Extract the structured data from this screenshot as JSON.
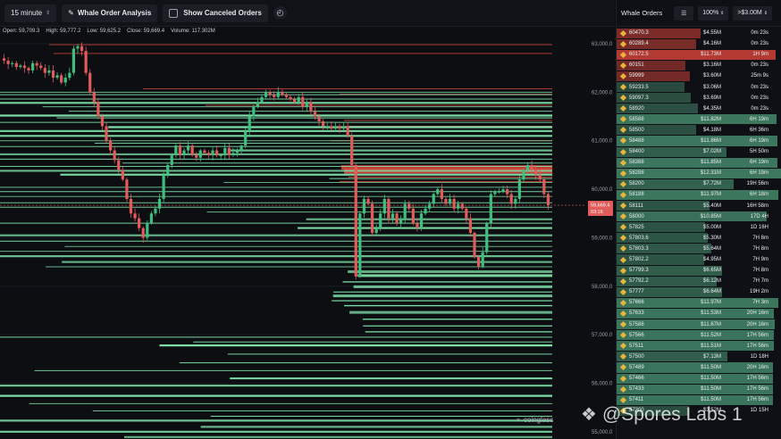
{
  "toolbar": {
    "interval": "15 minute",
    "whale_analysis": "Whale Order Analysis",
    "show_canceled": "Show Canceled Orders"
  },
  "ohlc": {
    "open": "Open: 59,709.3",
    "high": "High: 59,777.2",
    "low": "Low: 59,625.2",
    "close": "Close: 59,669.4",
    "volume": "Volume: 117.302M"
  },
  "price_tag": {
    "price": "59,669.4",
    "countdown": "03:16"
  },
  "colors": {
    "bid": "#7fe0a8",
    "ask": "#e2473b",
    "up": "#3fbf7f",
    "down": "#e25b5b"
  },
  "chart_data": {
    "type": "candlestick",
    "y_axis_ticks": [
      "63,000.0",
      "62,000.0",
      "61,000.0",
      "60,000.0",
      "59,000.0",
      "58,000.0",
      "57,000.0",
      "56,000.0",
      "55,000.0"
    ],
    "ylim": [
      54850,
      63350
    ],
    "current_price": 59669.4,
    "price_path": [
      62700,
      62650,
      62580,
      62600,
      62520,
      62550,
      62500,
      62450,
      62600,
      62550,
      62500,
      62400,
      62450,
      62300,
      62350,
      62200,
      62300,
      62400,
      62900,
      62950,
      62850,
      62400,
      62000,
      61800,
      61500,
      61300,
      61000,
      60800,
      60600,
      60400,
      60200,
      59800,
      59500,
      59400,
      59200,
      59000,
      59300,
      59500,
      59600,
      59800,
      60300,
      60500,
      60700,
      60900,
      60700,
      60800,
      60900,
      60700,
      60650,
      60800,
      60750,
      60700,
      60800,
      60700,
      60700,
      60850,
      60700,
      60750,
      60800,
      60900,
      61200,
      61500,
      61700,
      61800,
      61900,
      62000,
      61950,
      61900,
      62000,
      61950,
      61900,
      61850,
      61800,
      61900,
      61700,
      61800,
      61600,
      61500,
      61400,
      61300,
      61300,
      61250,
      61300,
      61250,
      61300,
      61100,
      60500,
      58200,
      59500,
      59800,
      59700,
      59100,
      59200,
      59500,
      59800,
      59400,
      59500,
      59300,
      59400,
      59700,
      59600,
      59300,
      59200,
      59500,
      59600,
      59700,
      59900,
      60000,
      59800,
      59700,
      59800,
      59600,
      59700,
      59600,
      59400,
      59100,
      58600,
      58400,
      58700,
      59300,
      59900,
      59950,
      59950,
      60000,
      59900,
      59700,
      59800,
      60200,
      60400,
      60500,
      60400,
      60300,
      60200,
      59900,
      59669
    ],
    "whale_bid_levels": [
      62000,
      61950,
      61860,
      61780,
      61700,
      61610,
      61520,
      61470,
      61380,
      61280,
      61200,
      61100,
      61000,
      60950,
      60880,
      60800,
      60720,
      60620,
      60540,
      60470,
      60380,
      60300,
      60220,
      60140,
      60040,
      59950,
      59850,
      59720,
      59630,
      59530,
      59380,
      59300,
      59200,
      59050,
      58930,
      58820,
      58720,
      58620,
      58500,
      58400,
      58300,
      58220,
      58090,
      57990,
      57880,
      57800,
      57700,
      57600,
      57460,
      57320,
      57180,
      57060,
      56950,
      56850,
      56780,
      56600,
      56420,
      56260,
      56100,
      55950,
      55740,
      55580,
      55430,
      55320,
      55230,
      55100,
      55000,
      54890
    ],
    "whale_ask_levels": [
      62980,
      62800,
      62070,
      61960,
      61730,
      61420,
      61300,
      61000,
      60450,
      60370,
      60250,
      60160
    ]
  },
  "panel": {
    "title": "Whale Orders",
    "zoom": "100%",
    "filter": ">$3.00M",
    "orders": [
      {
        "side": "ask",
        "price": "60470.3",
        "amount": "$4.55M",
        "time": "0m 23s"
      },
      {
        "side": "ask",
        "price": "60289.4",
        "amount": "$4.16M",
        "time": "0m 23s"
      },
      {
        "side": "ask",
        "price": "60172.5",
        "amount": "$11.73M",
        "time": "1H 9m"
      },
      {
        "side": "ask",
        "price": "60151",
        "amount": "$3.16M",
        "time": "0m 23s"
      },
      {
        "side": "ask",
        "price": "59999",
        "amount": "$3.60M",
        "time": "25m 9s"
      },
      {
        "side": "bid",
        "price": "59233.5",
        "amount": "$3.06M",
        "time": "0m 23s"
      },
      {
        "side": "bid",
        "price": "59097.3",
        "amount": "$3.69M",
        "time": "0m 23s"
      },
      {
        "side": "bid",
        "price": "58920",
        "amount": "$4.35M",
        "time": "0m 23s"
      },
      {
        "side": "bid",
        "price": "58588",
        "amount": "$11.82M",
        "time": "6H 19m"
      },
      {
        "side": "bid",
        "price": "58500",
        "amount": "$4.18M",
        "time": "6H 36m"
      },
      {
        "side": "bid",
        "price": "58488",
        "amount": "$11.86M",
        "time": "6H 19m"
      },
      {
        "side": "bid",
        "price": "58400",
        "amount": "$7.02M",
        "time": "5H 50m"
      },
      {
        "side": "bid",
        "price": "58388",
        "amount": "$11.85M",
        "time": "6H 19m"
      },
      {
        "side": "bid",
        "price": "58288",
        "amount": "$12.31M",
        "time": "6H 19m"
      },
      {
        "side": "bid",
        "price": "58200",
        "amount": "$7.72M",
        "time": "19H 56m"
      },
      {
        "side": "bid",
        "price": "58188",
        "amount": "$11.97M",
        "time": "6H 18m"
      },
      {
        "side": "bid",
        "price": "58111",
        "amount": "$5.40M",
        "time": "16H 58m"
      },
      {
        "side": "bid",
        "price": "58000",
        "amount": "$10.85M",
        "time": "17D 4H"
      },
      {
        "side": "bid",
        "price": "57825",
        "amount": "$5.00M",
        "time": "1D 16H"
      },
      {
        "side": "bid",
        "price": "57803.6",
        "amount": "$5.30M",
        "time": "7H 8m"
      },
      {
        "side": "bid",
        "price": "57803.3",
        "amount": "$5.64M",
        "time": "7H 8m"
      },
      {
        "side": "bid",
        "price": "57802.2",
        "amount": "$4.95M",
        "time": "7H 9m"
      },
      {
        "side": "bid",
        "price": "57799.3",
        "amount": "$6.65M",
        "time": "7H 8m"
      },
      {
        "side": "bid",
        "price": "57792.2",
        "amount": "$6.12M",
        "time": "7H 7m"
      },
      {
        "side": "bid",
        "price": "57777",
        "amount": "$6.64M",
        "time": "19H 2m"
      },
      {
        "side": "bid",
        "price": "57666",
        "amount": "$11.97M",
        "time": "7H 3m"
      },
      {
        "side": "bid",
        "price": "57633",
        "amount": "$11.53M",
        "time": "20H 16m"
      },
      {
        "side": "bid",
        "price": "57588",
        "amount": "$11.67M",
        "time": "20H 16m"
      },
      {
        "side": "bid",
        "price": "57566",
        "amount": "$11.52M",
        "time": "17H 56m"
      },
      {
        "side": "bid",
        "price": "57511",
        "amount": "$11.51M",
        "time": "17H 56m"
      },
      {
        "side": "bid",
        "price": "57500",
        "amount": "$7.13M",
        "time": "1D 18H"
      },
      {
        "side": "bid",
        "price": "57489",
        "amount": "$11.50M",
        "time": "20H 16m"
      },
      {
        "side": "bid",
        "price": "57466",
        "amount": "$11.50M",
        "time": "17H 56m"
      },
      {
        "side": "bid",
        "price": "57433",
        "amount": "$11.50M",
        "time": "17H 56m"
      },
      {
        "side": "bid",
        "price": "57411",
        "amount": "$11.50M",
        "time": "17H 56m"
      },
      {
        "side": "bid",
        "price": "57300",
        "amount": "$3.52M",
        "time": "1D 15H"
      }
    ]
  },
  "watermarks": {
    "coinglass": "coinglass",
    "spores": "@Spores Labs 1"
  }
}
